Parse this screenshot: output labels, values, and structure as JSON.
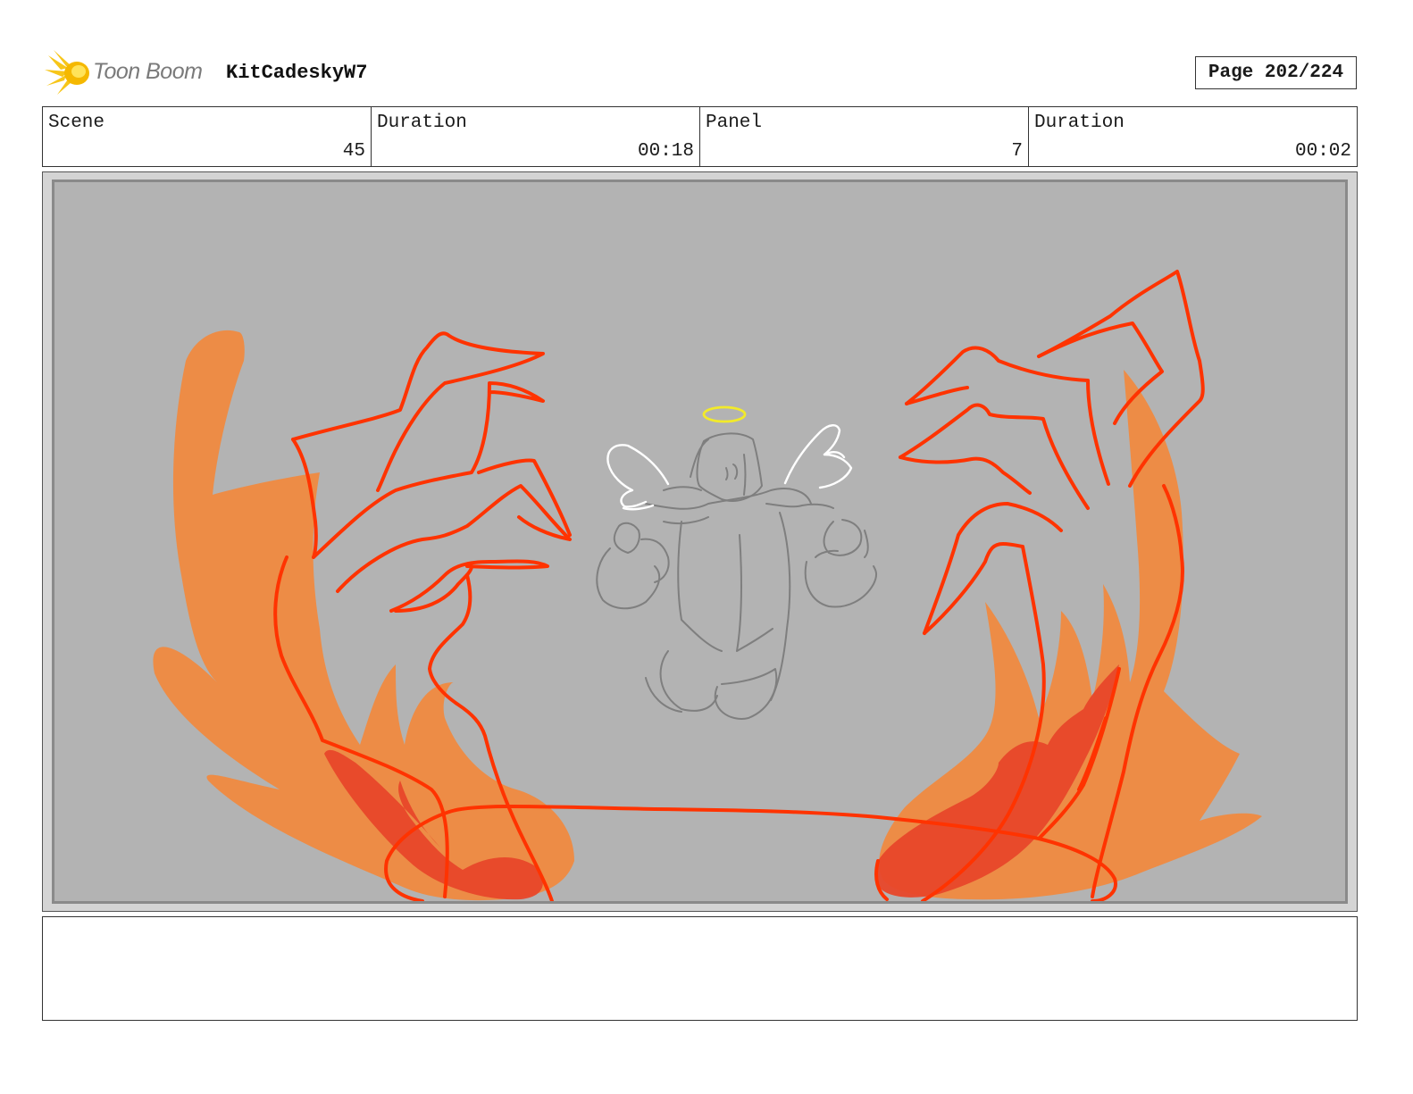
{
  "header": {
    "brand": "Toon Boom",
    "project_title": "KitCadeskyW7",
    "page_label": "Page 202/224"
  },
  "info": {
    "scene_label": "Scene",
    "scene_value": "45",
    "scene_duration_label": "Duration",
    "scene_duration_value": "00:18",
    "panel_label": "Panel",
    "panel_value": "7",
    "panel_duration_label": "Duration",
    "panel_duration_value": "00:02"
  },
  "panel": {
    "background_color": "#b3b3b3",
    "flame_color": "#f08a40",
    "outline_color": "#ff3300",
    "halo_color": "#f2ea2a"
  },
  "notes": {
    "text": ""
  }
}
